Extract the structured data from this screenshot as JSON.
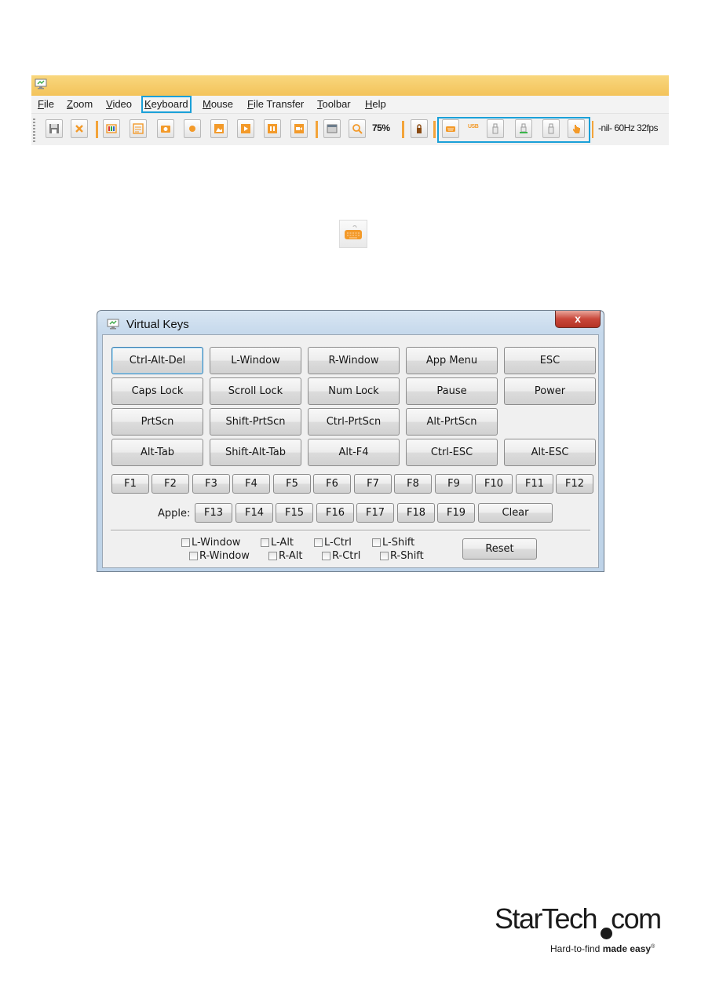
{
  "menu": {
    "file": {
      "first": "F",
      "rest": "ile"
    },
    "zoom": {
      "first": "Z",
      "rest": "oom"
    },
    "video": {
      "first": "V",
      "rest": "ideo"
    },
    "keyboard": {
      "first": "K",
      "rest": "eyboard"
    },
    "mouse": {
      "first": "M",
      "rest": "ouse"
    },
    "file_transfer": {
      "first": "F",
      "rest": "ile Transfer"
    },
    "toolbar": {
      "first": "T",
      "rest": "oolbar"
    },
    "help": {
      "first": "H",
      "rest": "elp"
    }
  },
  "toolbar": {
    "zoom_level": "75%",
    "usb_label": "USB",
    "status": "-nil- 60Hz 32fps"
  },
  "dialog": {
    "title": "Virtual Keys",
    "close_glyph": "x",
    "row1": [
      "Ctrl-Alt-Del",
      "L-Window",
      "R-Window",
      "App Menu",
      "ESC"
    ],
    "row2": [
      "Caps Lock",
      "Scroll Lock",
      "Num Lock",
      "Pause",
      "Power"
    ],
    "row3": [
      "PrtScn",
      "Shift-PrtScn",
      "Ctrl-PrtScn",
      "Alt-PrtScn"
    ],
    "row4": [
      "Alt-Tab",
      "Shift-Alt-Tab",
      "Alt-F4",
      "Ctrl-ESC",
      "Alt-ESC"
    ],
    "fkeys": [
      "F1",
      "F2",
      "F3",
      "F4",
      "F5",
      "F6",
      "F7",
      "F8",
      "F9",
      "F10",
      "F11",
      "F12"
    ],
    "apple_label": "Apple:",
    "apple_keys": [
      "F13",
      "F14",
      "F15",
      "F16",
      "F17",
      "F18",
      "F19"
    ],
    "clear": "Clear",
    "modifiers_top": [
      "L-Window",
      "L-Alt",
      "L-Ctrl",
      "L-Shift"
    ],
    "modifiers_bottom": [
      "R-Window",
      "R-Alt",
      "R-Ctrl",
      "R-Shift"
    ],
    "reset": "Reset"
  },
  "logo": {
    "name": "StarTech",
    "suffix": "com",
    "tagline_plain": "Hard-to-find ",
    "tagline_bold": "made easy",
    "registered": "®"
  },
  "colors": {
    "titlebar": "#f3c35a",
    "accent_orange": "#f39a2a",
    "highlight_blue": "#1aa0d8",
    "dialog_frame": "#c6d9ec",
    "close_red": "#c9473a"
  }
}
